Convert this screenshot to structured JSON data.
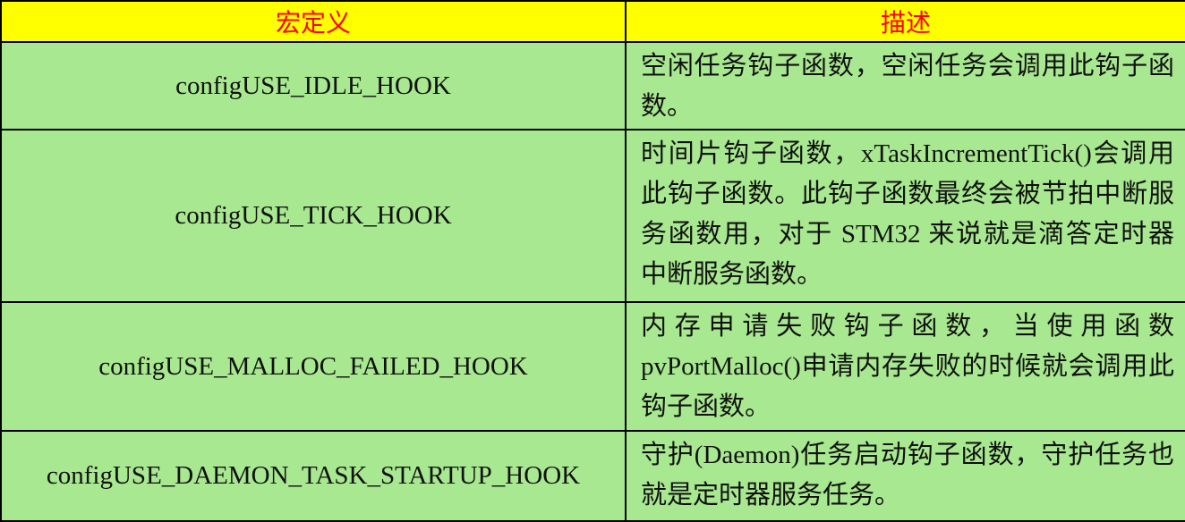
{
  "table": {
    "headers": {
      "macro": "宏定义",
      "description": "描述"
    },
    "rows": [
      {
        "macro": "configUSE_IDLE_HOOK",
        "description": "空闲任务钩子函数，空闲任务会调用此钩子函数。"
      },
      {
        "macro": "configUSE_TICK_HOOK",
        "description": "时间片钩子函数，xTaskIncrementTick()会调用此钩子函数。此钩子函数最终会被节拍中断服务函数用，对于 STM32 来说就是滴答定时器中断服务函数。"
      },
      {
        "macro": "configUSE_MALLOC_FAILED_HOOK",
        "description": "内存申请失败钩子函数，当使用函数pvPortMalloc()申请内存失败的时候就会调用此钩子函数。"
      },
      {
        "macro": "configUSE_DAEMON_TASK_STARTUP_HOOK",
        "description": "守护(Daemon)任务启动钩子函数，守护任务也就是定时器服务任务。"
      }
    ]
  },
  "colors": {
    "header_background": "#ffff00",
    "header_text": "#ff0000",
    "cell_background": "#a8e890",
    "border": "#000000"
  }
}
